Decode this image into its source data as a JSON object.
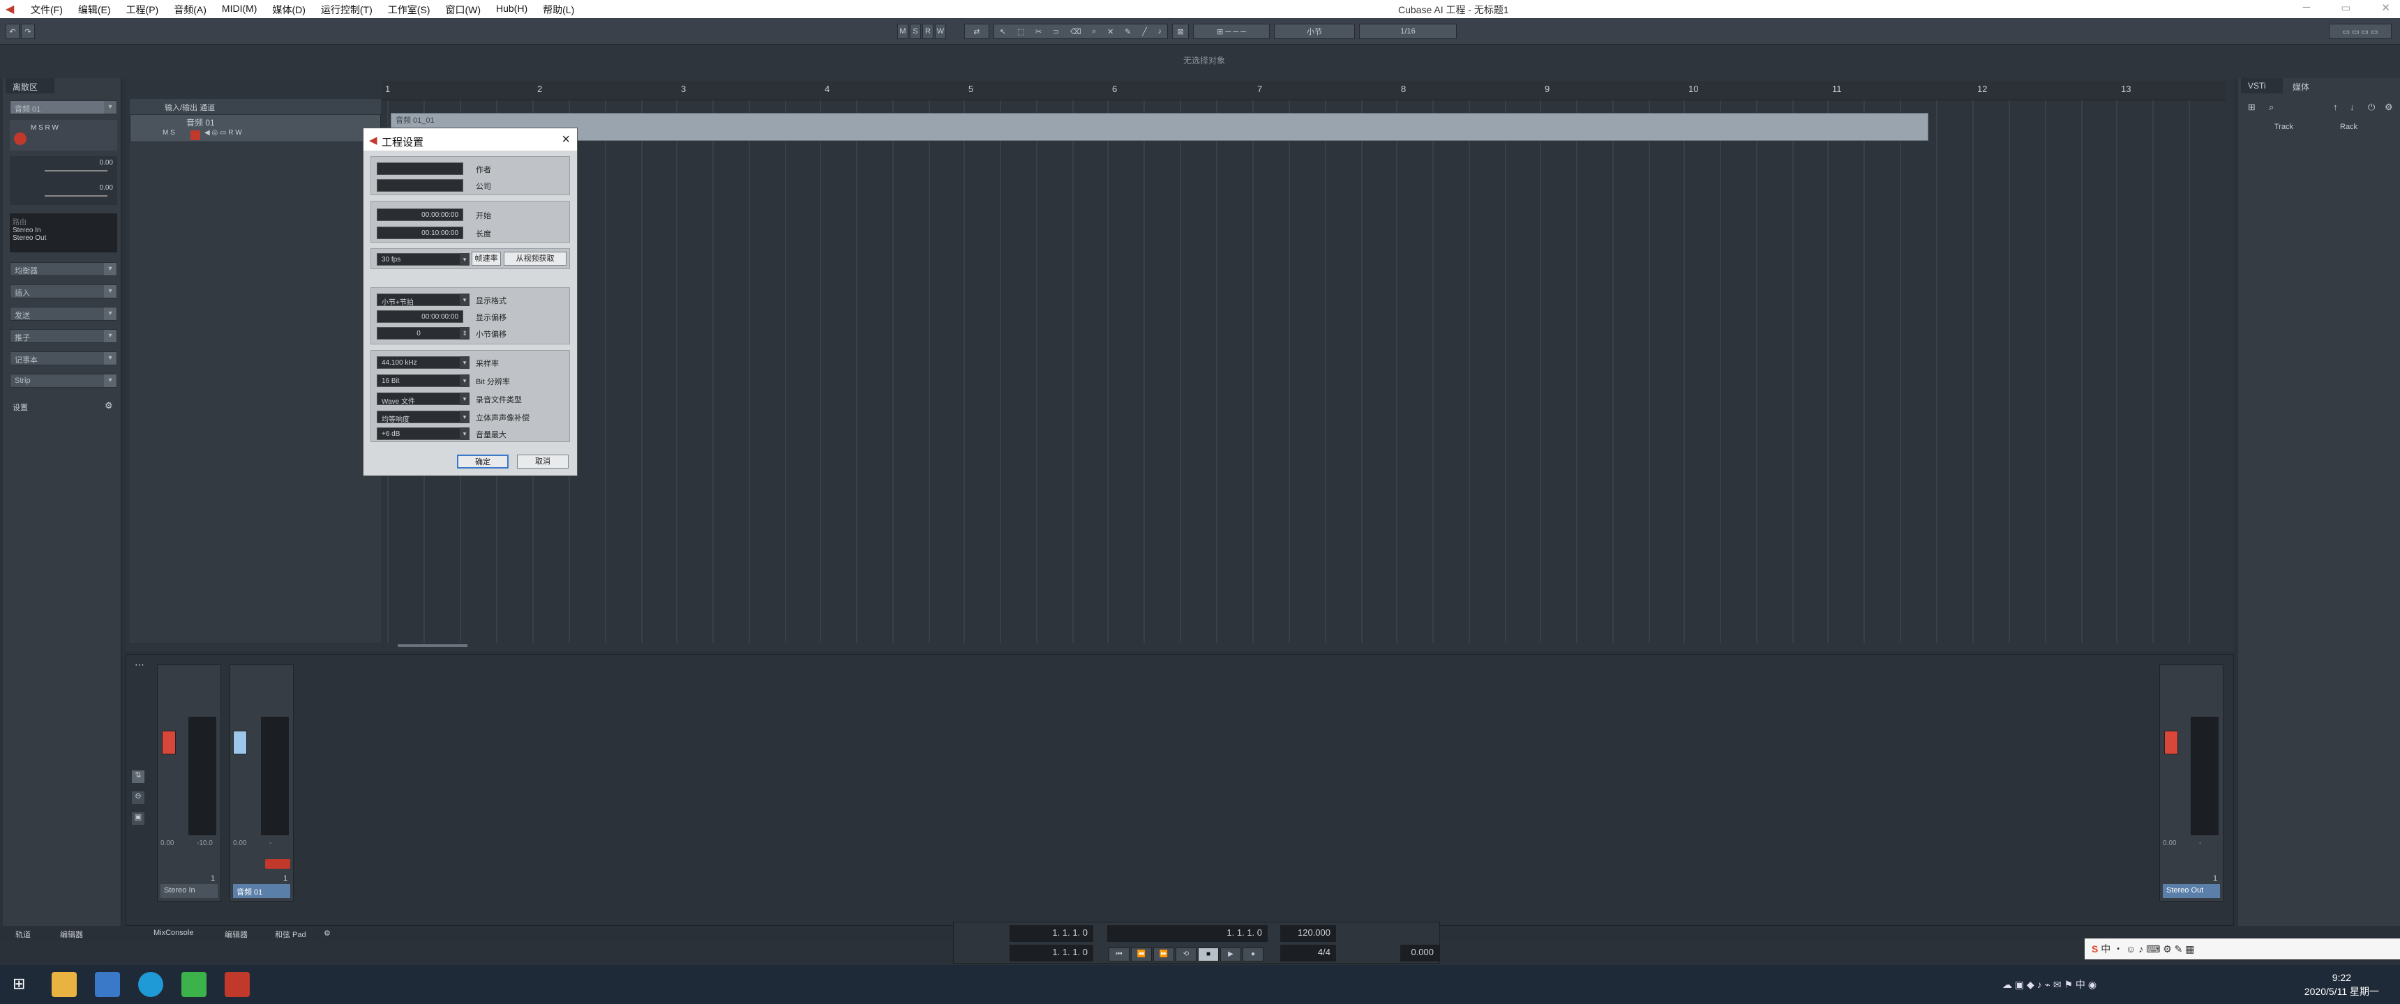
{
  "titlebar": {
    "menus": [
      "文件(F)",
      "编辑(E)",
      "工程(P)",
      "音频(A)",
      "MIDI(M)",
      "媒体(D)",
      "运行控制(T)",
      "工作室(S)",
      "窗口(W)",
      "Hub(H)",
      "帮助(L)"
    ],
    "title": "Cubase AI 工程 - 无标题1"
  },
  "toolbar": {
    "msrw": [
      "M",
      "S",
      "R",
      "W"
    ],
    "grid_type": "小节",
    "quantize": "1/16"
  },
  "statusline": {
    "text": "无选择对象"
  },
  "inspector": {
    "tab": "离散区",
    "track_name": "音频 01",
    "volume": "0.00",
    "pan": "0.00",
    "routing_in": "Stereo In",
    "routing_out": "Stereo Out",
    "sections": [
      "均衡器",
      "插入",
      "发送",
      "推子",
      "记事本",
      "Strip"
    ],
    "settings": "设置"
  },
  "tracklist": {
    "header": "输入/输出 通道",
    "track_name": "音频 01"
  },
  "ruler": {
    "bars": [
      "1",
      "2",
      "3",
      "4",
      "5",
      "6",
      "7",
      "8",
      "9",
      "10",
      "11",
      "12",
      "13"
    ]
  },
  "event": {
    "name": "音频 01_01"
  },
  "dialog": {
    "title": "工程设置",
    "author_label": "作者",
    "company_label": "公司",
    "start_value": "00:00:00:00",
    "start_label": "开始",
    "length_value": "00:10:00:00",
    "length_label": "长度",
    "fps_value": "30 fps",
    "get_from_video": "帧速率",
    "hmsf_button": "从视频获取",
    "display_format_value": "小节+节拍",
    "display_format_label": "显示格式",
    "display_offset_value": "00:00:00:00",
    "display_offset_label": "显示偏移",
    "bar_offset_value": "0",
    "bar_offset_label": "小节偏移",
    "sample_rate_value": "44.100 kHz",
    "sample_rate_label": "采样率",
    "bit_value": "16 Bit",
    "bit_label": "Bit 分辨率",
    "file_type_value": "Wave 文件",
    "file_type_label": "录音文件类型",
    "pan_law_value": "均等响度",
    "pan_law_label": "立体声声像补偿",
    "volume_max_value": "+6 dB",
    "volume_max_label": "音量最大",
    "ok": "确定",
    "cancel": "取消"
  },
  "mixer": {
    "strips": [
      {
        "name": "Stereo In",
        "value": "0.00",
        "value2": "-10.0"
      },
      {
        "name": "音频 01",
        "value": "0.00",
        "value2": "-"
      },
      {
        "name": "Stereo Out",
        "value": "0.00",
        "value2": "-"
      }
    ],
    "channel_number": "1"
  },
  "bottomtabs": {
    "left": [
      "轨道",
      "编辑器"
    ],
    "right": [
      "MixConsole",
      "编辑器",
      "和弦 Pad"
    ]
  },
  "transport": {
    "pos1": "1. 1. 1.  0",
    "pos2": "1. 1. 1.  0",
    "main_pos": "1. 1. 1.  0",
    "tempo": "120.000",
    "signature": "4/4",
    "time": "0.000"
  },
  "rightzone": {
    "tabs": [
      "VSTi",
      "媒体"
    ],
    "track_label": "Track",
    "rack_label": "Rack"
  },
  "taskbar": {
    "time": "9:22",
    "date": "2020/5/11 星期一",
    "ime": "中"
  }
}
